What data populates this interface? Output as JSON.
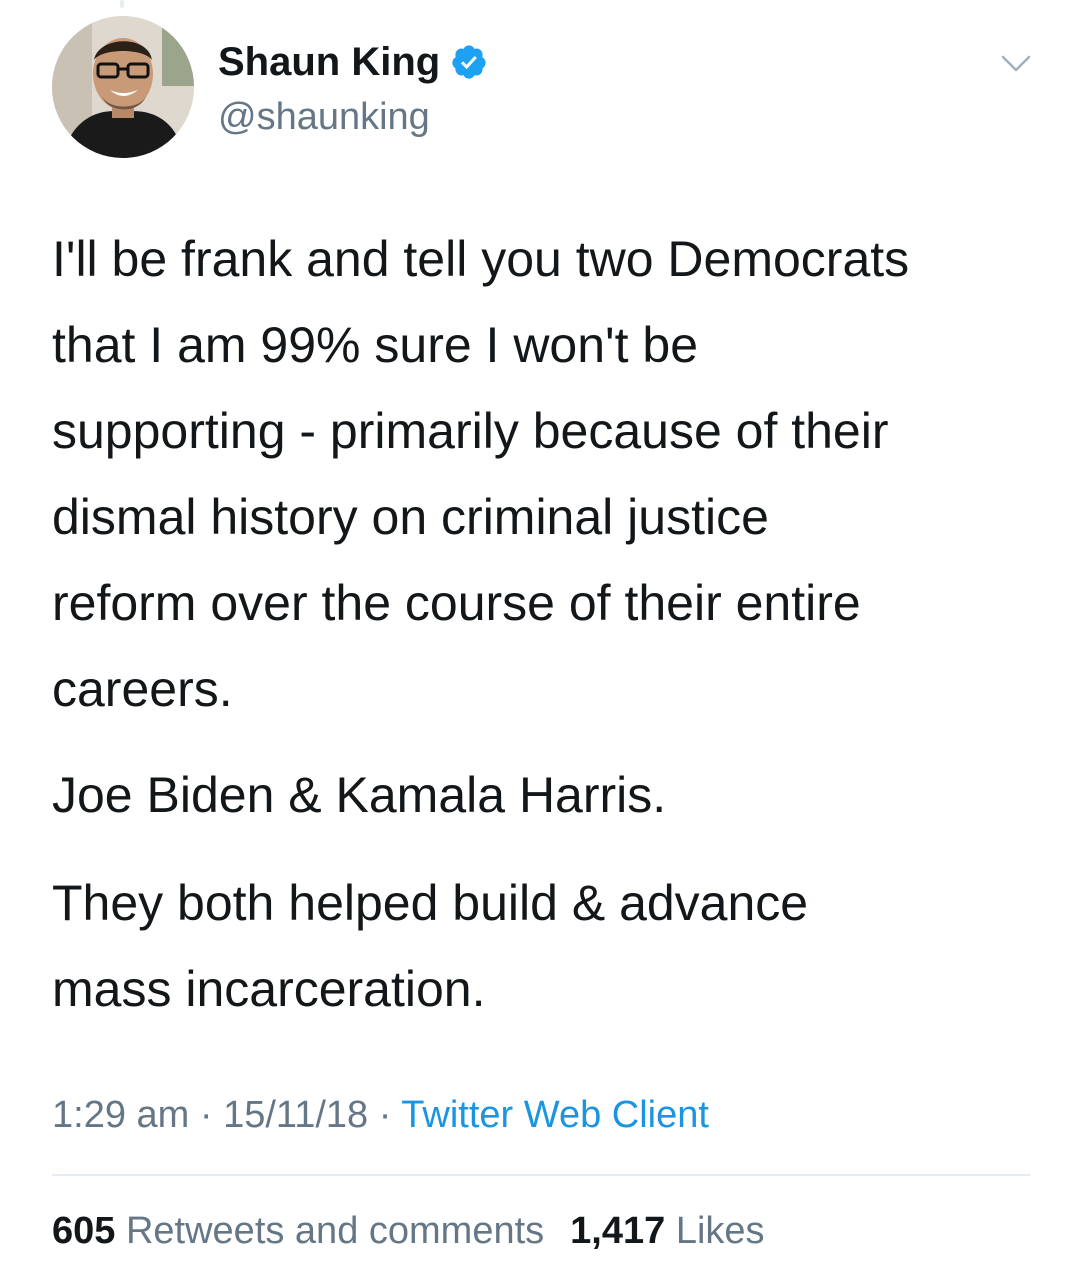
{
  "colors": {
    "text": "#14171a",
    "secondary": "#657786",
    "link": "#1b95e0",
    "verified": "#1da1f2",
    "divider": "#e6ecf0"
  },
  "user": {
    "display_name": "Shaun King",
    "handle": "@shaunking",
    "verified_icon": "verified-badge-icon",
    "avatar_icon": "profile-photo"
  },
  "header": {
    "menu_icon": "chevron-down-icon"
  },
  "tweet": {
    "paragraphs": [
      "I'll be frank and tell you two Democrats\nthat I am 99% sure I won't be\nsupporting - primarily because of their\ndismal history on criminal justice\nreform over the course of their entire\ncareers.",
      "Joe Biden & Kamala Harris.",
      "They both helped build & advance\nmass incarceration."
    ]
  },
  "meta": {
    "time": "1:29 am",
    "separator": " · ",
    "date": "15/11/18",
    "client": "Twitter Web Client"
  },
  "stats": {
    "retweets_count": "605",
    "retweets_label": "Retweets and comments",
    "likes_count": "1,417",
    "likes_label": "Likes"
  }
}
